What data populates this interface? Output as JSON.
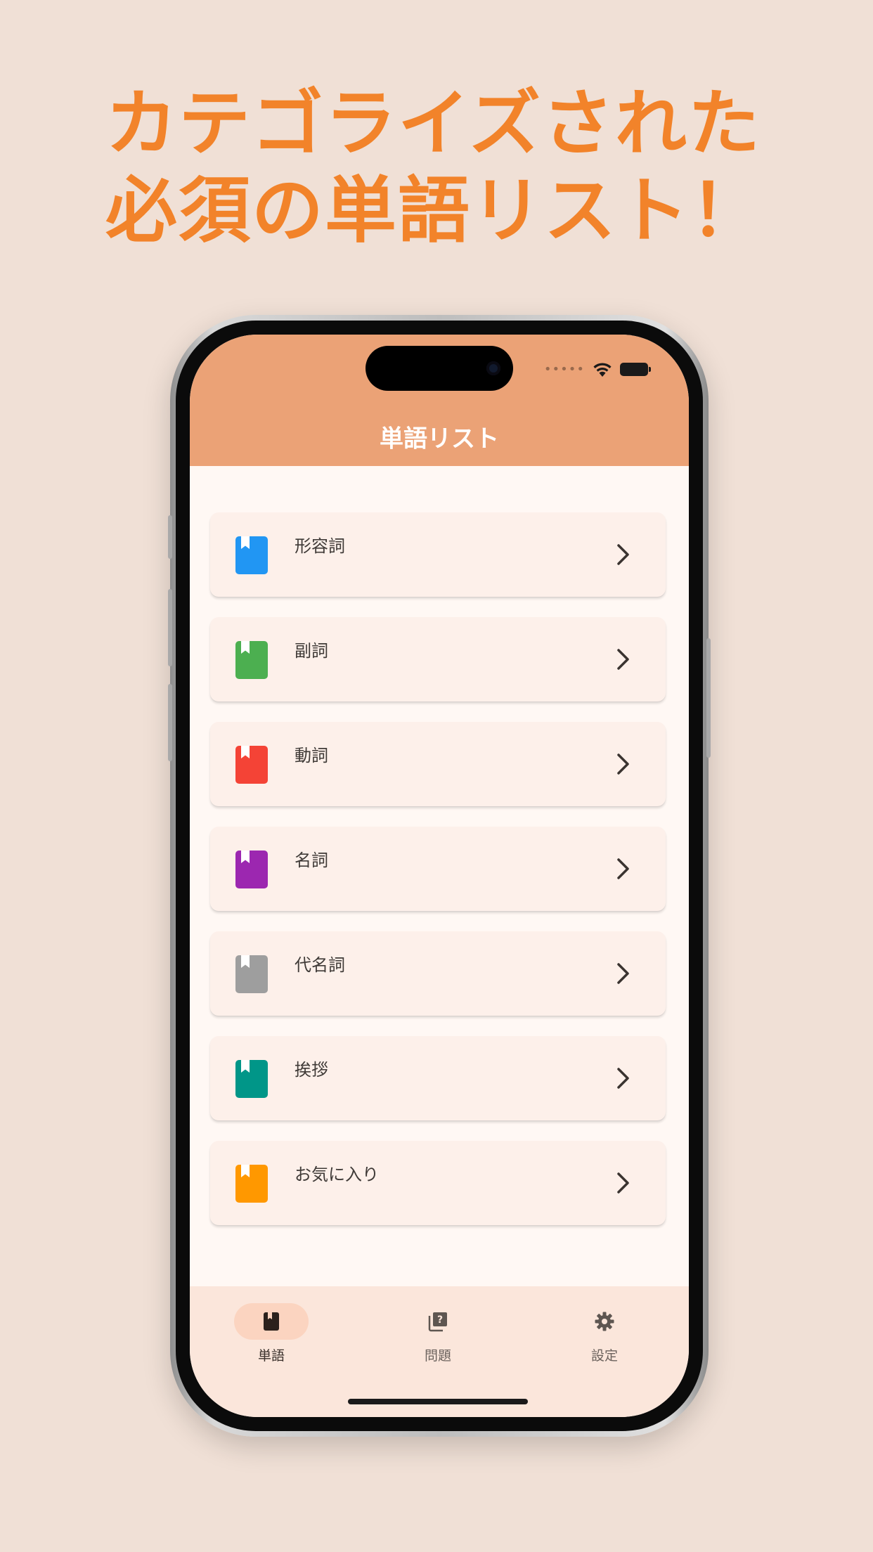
{
  "headline": {
    "line1": "カテゴライズされた",
    "line2": "必須の単語リスト！"
  },
  "appbar": {
    "title": "単語リスト"
  },
  "categories": [
    {
      "label": "形容詞",
      "color": "#2196f3",
      "icon": "book-icon"
    },
    {
      "label": "副詞",
      "color": "#4caf50",
      "icon": "book-icon"
    },
    {
      "label": "動詞",
      "color": "#f44336",
      "icon": "book-icon"
    },
    {
      "label": "名詞",
      "color": "#9c27b0",
      "icon": "book-icon"
    },
    {
      "label": "代名詞",
      "color": "#9e9e9e",
      "icon": "book-icon"
    },
    {
      "label": "挨拶",
      "color": "#009688",
      "icon": "book-icon"
    },
    {
      "label": "お気に入り",
      "color": "#ff9800",
      "icon": "book-icon"
    }
  ],
  "tabs": [
    {
      "label": "単語",
      "icon": "book-icon",
      "active": true
    },
    {
      "label": "問題",
      "icon": "quiz-icon",
      "active": false
    },
    {
      "label": "設定",
      "icon": "gear-icon",
      "active": false
    }
  ],
  "colors": {
    "headline": "#f2832a",
    "appbar": "#eba276",
    "background": "#f0e0d6"
  }
}
